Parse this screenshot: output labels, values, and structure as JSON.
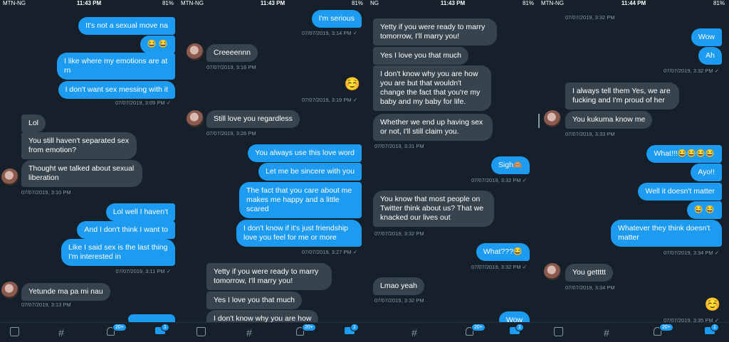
{
  "panels": [
    {
      "status": {
        "carrier": "MTN-NG",
        "time": "11:43 PM",
        "right": "81%"
      },
      "messages": [
        {
          "text": "It's not a sexual move na"
        },
        {
          "text": "😂 😂"
        },
        {
          "text": "I like where my emotions are at rn"
        },
        {
          "text": "I don't want sex messing with it"
        },
        {
          "ts": "07/07/2019, 3:09 PM ✓"
        },
        {
          "text": "Lol"
        },
        {
          "text": "You still haven't separated sex from emotion?"
        },
        {
          "text": "Thought we talked about sexual liberation"
        },
        {
          "ts": "07/07/2019, 3:10 PM"
        },
        {
          "text": "Lol well I haven't"
        },
        {
          "text": "And I don't think I want to"
        },
        {
          "text": "Like I said sex is the last thing I'm interested in"
        },
        {
          "ts": "07/07/2019, 3:11 PM ✓"
        },
        {
          "text": "Yetunde ma pa mi nau"
        },
        {
          "ts": "07/07/2019, 3:13 PM"
        }
      ],
      "tabs": {
        "badge1": "20+",
        "badge2": "1"
      }
    },
    {
      "status": {
        "carrier": "MTN-NG",
        "time": "11:43 PM",
        "right": "81%"
      },
      "messages": [
        {
          "text": "I'm serious"
        },
        {
          "ts": "07/07/2019, 3:14 PM ✓"
        },
        {
          "text": "Creeeennn"
        },
        {
          "ts": "07/07/2019, 3:16 PM"
        },
        {
          "text": "☺️"
        },
        {
          "ts": "07/07/2019, 3:19 PM ✓"
        },
        {
          "text": "Still love you regardless"
        },
        {
          "ts": "07/07/2019, 3:26 PM"
        },
        {
          "text": "You always use this love word"
        },
        {
          "text": "Let me be sincere with you"
        },
        {
          "text": "The fact that you care about me makes me happy and a little scared"
        },
        {
          "text": "I don't know if it's just friendship love you feel for me or more"
        },
        {
          "ts": "07/07/2019, 3:27 PM ✓"
        },
        {
          "text": "Yetty if you were ready to marry tomorrow, I'll marry you!"
        },
        {
          "text": "Yes I love you that much"
        },
        {
          "text": "I don't know why you are how"
        }
      ],
      "tabs": {
        "badge1": "20+",
        "badge2": "1"
      }
    },
    {
      "status": {
        "carrier": "NG",
        "time": "11:43 PM",
        "right": "81%"
      },
      "messages": [
        {
          "text": "Yetty if you were ready to marry tomorrow, I'll marry you!"
        },
        {
          "text": "Yes I love you that much"
        },
        {
          "text": "I don't know why you are how you are but that wouldn't change the fact that you're my baby and my baby for life."
        },
        {
          "text": "Whether we end up having sex or not, I'll still claim you."
        },
        {
          "ts": "07/07/2019, 3:31 PM"
        },
        {
          "text": "Sigh🙈"
        },
        {
          "ts": "07/07/2019, 3:32 PM ✓"
        },
        {
          "text": "You know that most people on Twitter think about us? That we knacked our lives out"
        },
        {
          "ts": "07/07/2019, 3:32 PM"
        },
        {
          "text": "What???😂"
        },
        {
          "ts": "07/07/2019, 3:32 PM ✓"
        },
        {
          "text": "Lmao yeah"
        },
        {
          "ts": "07/07/2019, 3:32 PM"
        },
        {
          "text": "Wow"
        }
      ],
      "tabs": {
        "badge1": "20+",
        "badge2": "1"
      }
    },
    {
      "status": {
        "carrier": "MTN-NG",
        "time": "11:44 PM",
        "right": "81%"
      },
      "messages": [
        {
          "ts": "07/07/2019, 3:32 PM"
        },
        {
          "text": "Wow"
        },
        {
          "text": "Ah"
        },
        {
          "ts": "07/07/2019, 3:32 PM ✓"
        },
        {
          "text": "I always tell them Yes, we are fucking and I'm proud of her"
        },
        {
          "text": "You kukuma know me"
        },
        {
          "ts": "07/07/2019, 3:33 PM"
        },
        {
          "text": "What!!!😂😂😂😂"
        },
        {
          "text": "Ayo!!"
        },
        {
          "text": "Well it doesn't matter"
        },
        {
          "text": "😂 😂"
        },
        {
          "text": "Whatever they think doesn't matter"
        },
        {
          "ts": "07/07/2019, 3:34 PM ✓"
        },
        {
          "text": "You gettttt"
        },
        {
          "ts": "07/07/2019, 3:34 PM"
        },
        {
          "text": "☺️"
        },
        {
          "ts": "07/07/2019, 3:35 PM ✓"
        }
      ],
      "tabs": {
        "badge1": "20+",
        "badge2": "1"
      }
    }
  ]
}
